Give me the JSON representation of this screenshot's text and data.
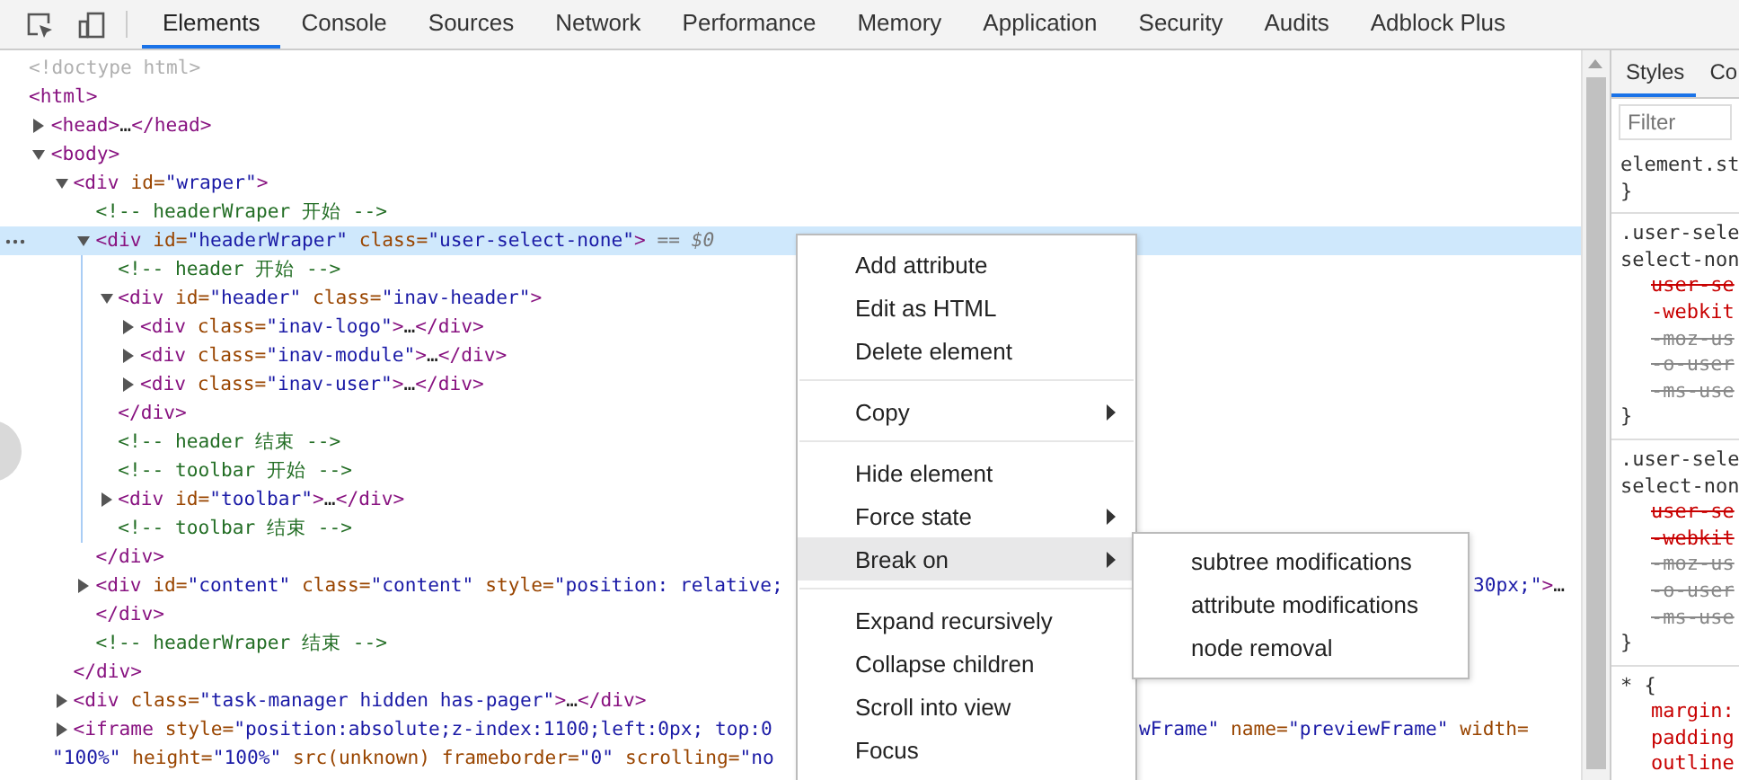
{
  "toolbar": {
    "tabs": [
      {
        "label": "Elements",
        "selected": true
      },
      {
        "label": "Console",
        "selected": false
      },
      {
        "label": "Sources",
        "selected": false
      },
      {
        "label": "Network",
        "selected": false
      },
      {
        "label": "Performance",
        "selected": false
      },
      {
        "label": "Memory",
        "selected": false
      },
      {
        "label": "Application",
        "selected": false
      },
      {
        "label": "Security",
        "selected": false
      },
      {
        "label": "Audits",
        "selected": false
      },
      {
        "label": "Adblock Plus",
        "selected": false
      }
    ]
  },
  "tree": [
    {
      "tokens": [
        {
          "kind": "doctype",
          "text": "<!doctype html>"
        }
      ]
    },
    {
      "tokens": [
        {
          "kind": "tag",
          "text": "<html>"
        }
      ],
      "children": [
        {
          "tokens": [
            {
              "kind": "tag",
              "text": "<head>"
            },
            {
              "kind": "plain",
              "text": "…"
            },
            {
              "kind": "tag",
              "text": "</head>"
            }
          ],
          "expanded": false
        },
        {
          "tokens": [
            {
              "kind": "tag",
              "text": "<body>"
            }
          ],
          "expanded": true,
          "children": [
            {
              "tokens": [
                {
                  "kind": "tag",
                  "text": "<div"
                },
                {
                  "kind": "attr",
                  "text": " id="
                },
                {
                  "kind": "value",
                  "text": "\"wraper\""
                },
                {
                  "kind": "tag",
                  "text": ">"
                }
              ],
              "expanded": true,
              "children": [
                {
                  "tokens": [
                    {
                      "kind": "comment",
                      "text": "<!-- headerWraper 开始 -->"
                    }
                  ]
                },
                {
                  "tokens": [
                    {
                      "kind": "tag",
                      "text": "<div"
                    },
                    {
                      "kind": "attr",
                      "text": " id="
                    },
                    {
                      "kind": "value",
                      "text": "\"headerWraper\""
                    },
                    {
                      "kind": "attr",
                      "text": " class="
                    },
                    {
                      "kind": "value",
                      "text": "\"user-select-none\""
                    },
                    {
                      "kind": "tag",
                      "text": ">"
                    },
                    {
                      "kind": "hint",
                      "text": " == $0"
                    }
                  ],
                  "expanded": true,
                  "selected": true,
                  "children": [
                    {
                      "tokens": [
                        {
                          "kind": "comment",
                          "text": "<!-- header 开始 -->"
                        }
                      ]
                    },
                    {
                      "tokens": [
                        {
                          "kind": "tag",
                          "text": "<div"
                        },
                        {
                          "kind": "attr",
                          "text": " id="
                        },
                        {
                          "kind": "value",
                          "text": "\"header\""
                        },
                        {
                          "kind": "attr",
                          "text": " class="
                        },
                        {
                          "kind": "value",
                          "text": "\"inav-header\""
                        },
                        {
                          "kind": "tag",
                          "text": ">"
                        }
                      ],
                      "expanded": true,
                      "children": [
                        {
                          "tokens": [
                            {
                              "kind": "tag",
                              "text": "<div"
                            },
                            {
                              "kind": "attr",
                              "text": " class="
                            },
                            {
                              "kind": "value",
                              "text": "\"inav-logo\""
                            },
                            {
                              "kind": "tag",
                              "text": ">"
                            },
                            {
                              "kind": "plain",
                              "text": "…"
                            },
                            {
                              "kind": "tag",
                              "text": "</div>"
                            }
                          ],
                          "expanded": false
                        },
                        {
                          "tokens": [
                            {
                              "kind": "tag",
                              "text": "<div"
                            },
                            {
                              "kind": "attr",
                              "text": " class="
                            },
                            {
                              "kind": "value",
                              "text": "\"inav-module\""
                            },
                            {
                              "kind": "tag",
                              "text": ">"
                            },
                            {
                              "kind": "plain",
                              "text": "…"
                            },
                            {
                              "kind": "tag",
                              "text": "</div>"
                            }
                          ],
                          "expanded": false
                        },
                        {
                          "tokens": [
                            {
                              "kind": "tag",
                              "text": "<div"
                            },
                            {
                              "kind": "attr",
                              "text": " class="
                            },
                            {
                              "kind": "value",
                              "text": "\"inav-user\""
                            },
                            {
                              "kind": "tag",
                              "text": ">"
                            },
                            {
                              "kind": "plain",
                              "text": "…"
                            },
                            {
                              "kind": "tag",
                              "text": "</div>"
                            }
                          ],
                          "expanded": false
                        }
                      ],
                      "close": [
                        {
                          "kind": "tag",
                          "text": "</div>"
                        }
                      ]
                    },
                    {
                      "tokens": [
                        {
                          "kind": "comment",
                          "text": "<!-- header 结束 -->"
                        }
                      ]
                    },
                    {
                      "tokens": [
                        {
                          "kind": "comment",
                          "text": "<!-- toolbar 开始 -->"
                        }
                      ]
                    },
                    {
                      "tokens": [
                        {
                          "kind": "tag",
                          "text": "<div"
                        },
                        {
                          "kind": "attr",
                          "text": " id="
                        },
                        {
                          "kind": "value",
                          "text": "\"toolbar\""
                        },
                        {
                          "kind": "tag",
                          "text": ">"
                        },
                        {
                          "kind": "plain",
                          "text": "…"
                        },
                        {
                          "kind": "tag",
                          "text": "</div>"
                        }
                      ],
                      "expanded": false
                    },
                    {
                      "tokens": [
                        {
                          "kind": "comment",
                          "text": "<!-- toolbar 结束 -->"
                        }
                      ]
                    }
                  ],
                  "close": [
                    {
                      "kind": "tag",
                      "text": "</div>"
                    }
                  ]
                },
                {
                  "tokens": [
                    {
                      "kind": "tag",
                      "text": "<div"
                    },
                    {
                      "kind": "attr",
                      "text": " id="
                    },
                    {
                      "kind": "value",
                      "text": "\"content\""
                    },
                    {
                      "kind": "attr",
                      "text": " class="
                    },
                    {
                      "kind": "value",
                      "text": "\"content\""
                    },
                    {
                      "kind": "attr",
                      "text": " style="
                    },
                    {
                      "kind": "value",
                      "text": "\"position: relative;"
                    }
                  ],
                  "tail": {
                    "kind": "submenu",
                    "tokens": [
                      {
                        "kind": "value",
                        "text": "30px;\""
                      },
                      {
                        "kind": "tag",
                        "text": ">"
                      },
                      {
                        "kind": "plain",
                        "text": "…"
                      }
                    ]
                  },
                  "expanded": false
                },
                {
                  "tokens": [
                    {
                      "kind": "tag",
                      "text": "</div>"
                    }
                  ]
                },
                {
                  "tokens": [
                    {
                      "kind": "comment",
                      "text": "<!-- headerWraper 结束 -->"
                    }
                  ]
                }
              ],
              "close": [
                {
                  "kind": "tag",
                  "text": "</div>"
                }
              ]
            },
            {
              "tokens": [
                {
                  "kind": "tag",
                  "text": "<div"
                },
                {
                  "kind": "attr",
                  "text": " class="
                },
                {
                  "kind": "value",
                  "text": "\"task-manager hidden has-pager\""
                },
                {
                  "kind": "tag",
                  "text": ">"
                },
                {
                  "kind": "plain",
                  "text": "…"
                },
                {
                  "kind": "tag",
                  "text": "</div>"
                }
              ],
              "expanded": false
            },
            {
              "tokens": [
                {
                  "kind": "tag",
                  "text": "<iframe"
                },
                {
                  "kind": "attr",
                  "text": " style="
                },
                {
                  "kind": "value",
                  "text": "\"position:absolute;z-index:1100;left:0px; top:0"
                }
              ],
              "tail": {
                "kind": "menu",
                "tokens": [
                  {
                    "kind": "value",
                    "text": "wFrame\""
                  },
                  {
                    "kind": "attr",
                    "text": " name="
                  },
                  {
                    "kind": "value",
                    "text": "\"previewFrame\""
                  },
                  {
                    "kind": "attr",
                    "text": " width="
                  }
                ]
              },
              "continuation": [
                {
                  "kind": "value",
                  "text": "\"100%\""
                },
                {
                  "kind": "attr",
                  "text": " height="
                },
                {
                  "kind": "value",
                  "text": "\"100%\""
                },
                {
                  "kind": "attr",
                  "text": " src(unknown) frameborder="
                },
                {
                  "kind": "value",
                  "text": "\"0\""
                },
                {
                  "kind": "attr",
                  "text": " scrolling="
                },
                {
                  "kind": "value",
                  "text": "\"no"
                }
              ],
              "expanded": false
            }
          ]
        }
      ]
    }
  ],
  "context_menu": {
    "items": [
      {
        "kind": "item",
        "label": "Add attribute",
        "submenu": false,
        "selected": false
      },
      {
        "kind": "item",
        "label": "Edit as HTML",
        "submenu": false,
        "selected": false
      },
      {
        "kind": "item",
        "label": "Delete element",
        "submenu": false,
        "selected": false
      },
      {
        "kind": "separator"
      },
      {
        "kind": "item",
        "label": "Copy",
        "submenu": true,
        "selected": false
      },
      {
        "kind": "separator"
      },
      {
        "kind": "item",
        "label": "Hide element",
        "submenu": false,
        "selected": false
      },
      {
        "kind": "item",
        "label": "Force state",
        "submenu": true,
        "selected": false
      },
      {
        "kind": "item",
        "label": "Break on",
        "submenu": true,
        "selected": true
      },
      {
        "kind": "separator"
      },
      {
        "kind": "item",
        "label": "Expand recursively",
        "submenu": false,
        "selected": false
      },
      {
        "kind": "item",
        "label": "Collapse children",
        "submenu": false,
        "selected": false
      },
      {
        "kind": "item",
        "label": "Scroll into view",
        "submenu": false,
        "selected": false
      },
      {
        "kind": "item",
        "label": "Focus",
        "submenu": false,
        "selected": false
      }
    ]
  },
  "submenu": {
    "items": [
      {
        "label": "subtree modifications"
      },
      {
        "label": "attribute modifications"
      },
      {
        "label": "node removal"
      }
    ]
  },
  "styles_pane": {
    "tabs": [
      {
        "label": "Styles",
        "selected": true
      },
      {
        "label": "Co",
        "selected": false
      }
    ],
    "filter": {
      "placeholder": "Filter"
    },
    "rules": [
      {
        "selector": [
          "element.st"
        ],
        "close": "}"
      },
      {
        "selector": [
          ".user-sele",
          "select-non"
        ],
        "props": [
          {
            "text": "user-se",
            "crossed": true,
            "inactive": false
          },
          {
            "text": "-webkit",
            "crossed": false,
            "inactive": false
          },
          {
            "text": "-moz-us",
            "crossed": true,
            "inactive": true
          },
          {
            "text": "-o-user",
            "crossed": true,
            "inactive": true
          },
          {
            "text": "-ms-use",
            "crossed": true,
            "inactive": true
          }
        ],
        "close": "}"
      },
      {
        "selector": [
          ".user-sele",
          "select-non"
        ],
        "props": [
          {
            "text": "user-se",
            "crossed": true,
            "inactive": false
          },
          {
            "text": "-webkit",
            "crossed": true,
            "inactive": false
          },
          {
            "text": "-moz-us",
            "crossed": true,
            "inactive": true
          },
          {
            "text": "-o-user",
            "crossed": true,
            "inactive": true
          },
          {
            "text": "-ms-use",
            "crossed": true,
            "inactive": true
          }
        ],
        "close": "}"
      },
      {
        "selector": [
          "* {"
        ],
        "props": [
          {
            "text": "margin:",
            "crossed": false,
            "inactive": false
          },
          {
            "text": "padding",
            "crossed": false,
            "inactive": false
          },
          {
            "text": "outline",
            "crossed": false,
            "inactive": false
          }
        ]
      }
    ]
  }
}
